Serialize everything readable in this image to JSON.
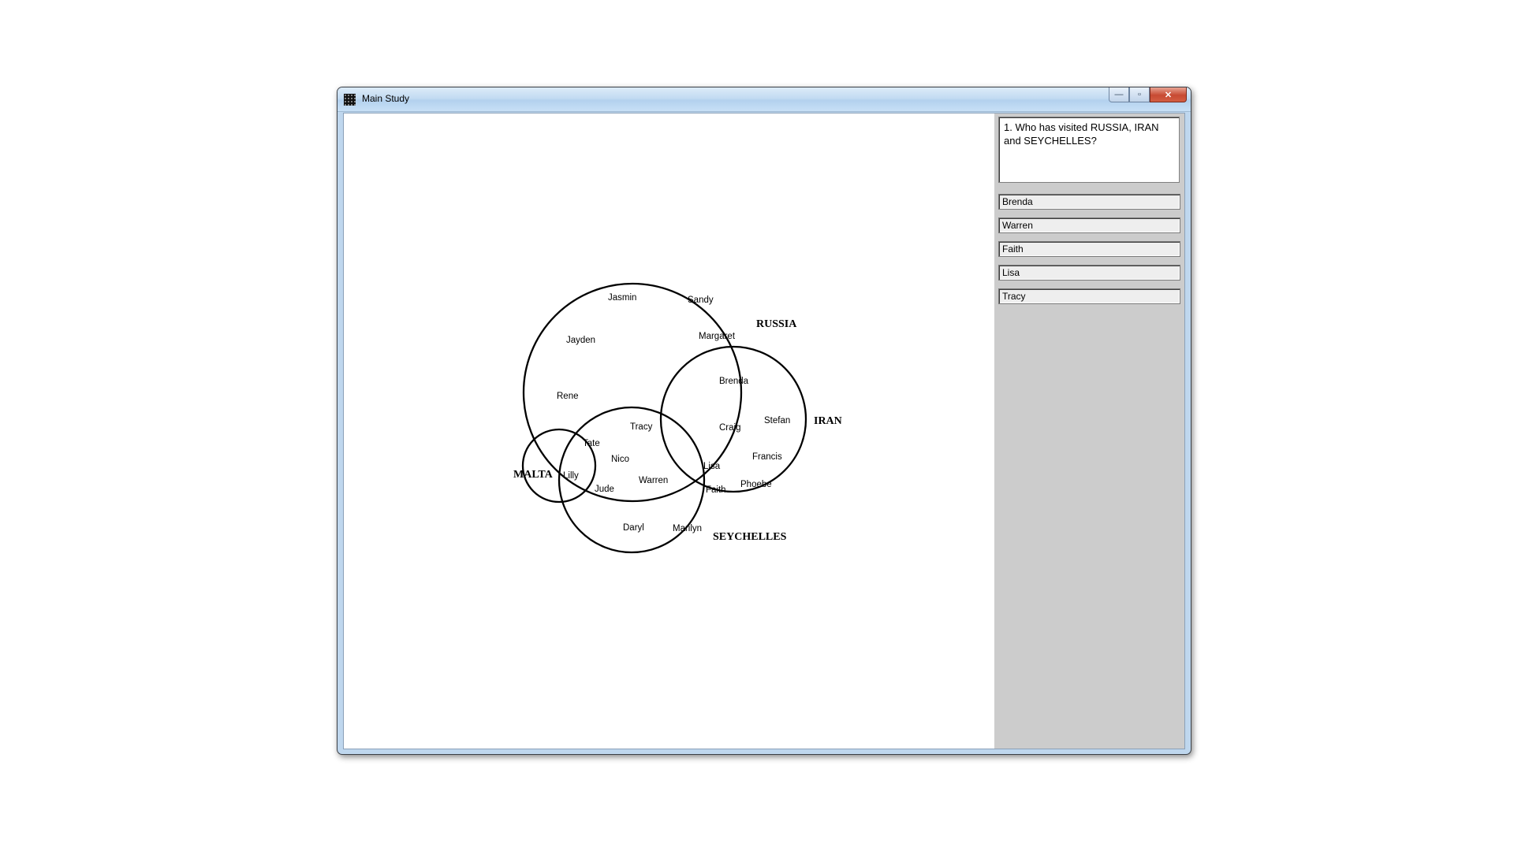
{
  "window": {
    "title": "Main Study",
    "controls": {
      "minimize": "—",
      "maximize": "▫",
      "close": "✕"
    }
  },
  "question": {
    "text": "1. Who has visited RUSSIA, IRAN and SEYCHELLES?"
  },
  "answers": [
    "Brenda",
    "Warren",
    "Faith",
    "Lisa",
    "Tracy"
  ],
  "diagram": {
    "sets": {
      "russia": "RUSSIA",
      "iran": "IRAN",
      "malta": "MALTA",
      "seychelles": "SEYCHELLES"
    },
    "people": {
      "jasmin": "Jasmin",
      "sandy": "Sandy",
      "jayden": "Jayden",
      "margaret": "Margaret",
      "rene": "Rene",
      "brenda": "Brenda",
      "tracy": "Tracy",
      "craig": "Craig",
      "stefan": "Stefan",
      "tate": "Tate",
      "nico": "Nico",
      "lisa": "Lisa",
      "francis": "Francis",
      "lilly": "Lilly",
      "warren": "Warren",
      "jude": "Jude",
      "faith": "Faith",
      "phoebe": "Phoebe",
      "daryl": "Daryl",
      "marilyn": "Marilyn"
    }
  }
}
